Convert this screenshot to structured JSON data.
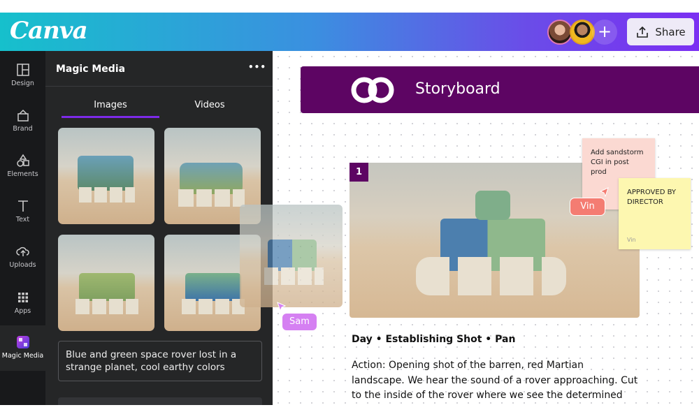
{
  "app": {
    "logo": "Canva",
    "share_label": "Share",
    "add_collaborator": "+"
  },
  "colors": {
    "accent": "#7d2ae8",
    "banner": "#5d0563",
    "vin_tag": "#f47c72",
    "sam_tag": "#d580f2",
    "sticky_pink": "#fbd9d2",
    "sticky_yellow": "#fdf7b0"
  },
  "sidebar": {
    "items": [
      {
        "label": "Design",
        "icon": "layout-icon"
      },
      {
        "label": "Brand",
        "icon": "brand-icon"
      },
      {
        "label": "Elements",
        "icon": "shapes-icon"
      },
      {
        "label": "Text",
        "icon": "text-icon"
      },
      {
        "label": "Uploads",
        "icon": "cloud-upload-icon"
      },
      {
        "label": "Apps",
        "icon": "grid-icon"
      },
      {
        "label": "Magic Media",
        "icon": "magic-media-icon",
        "active": true
      }
    ]
  },
  "panel": {
    "title": "Magic Media",
    "more": "•••",
    "tabs": [
      {
        "label": "Images",
        "active": true
      },
      {
        "label": "Videos"
      }
    ],
    "prompt": "Blue and green space rover lost in a strange planet, cool earthy colors"
  },
  "canvas": {
    "banner_title": "Storyboard",
    "scene_number": "1",
    "scene_heading": "Day • Establishing Shot • Pan",
    "scene_action": "Action: Opening shot of the barren, red Martian landscape. We hear the sound of a rover approaching. Cut to the inside of the rover where we see the determined face of our",
    "sticky_pink": "Add sandstorm CGI in post prod",
    "sticky_yellow": "APPROVED BY DIRECTOR",
    "sticky_yellow_author": "Vin",
    "cursor_vin": "Vin",
    "cursor_sam": "Sam"
  }
}
